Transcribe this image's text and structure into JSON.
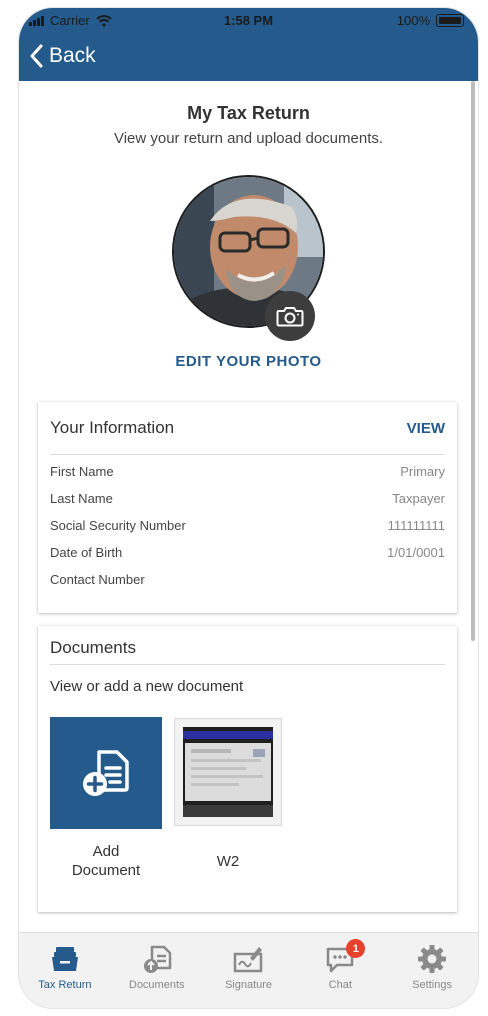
{
  "status_bar": {
    "carrier": "Carrier",
    "time": "1:58 PM",
    "battery": "100%"
  },
  "nav": {
    "back_label": "Back"
  },
  "page": {
    "title": "My Tax Return",
    "subtitle": "View your return and upload documents.",
    "edit_photo": "EDIT YOUR PHOTO"
  },
  "your_information": {
    "title": "Your Information",
    "view_label": "VIEW",
    "rows": [
      {
        "label": "First Name",
        "value": "Primary"
      },
      {
        "label": "Last Name",
        "value": "Taxpayer"
      },
      {
        "label": "Social Security Number",
        "value": "111111111"
      },
      {
        "label": "Date of Birth",
        "value": "1/01/0001"
      },
      {
        "label": "Contact Number",
        "value": ""
      }
    ]
  },
  "documents": {
    "title": "Documents",
    "subtitle": "View or add a new document",
    "add_label_line1": "Add",
    "add_label_line2": "Document",
    "items": [
      {
        "label": "W2"
      }
    ]
  },
  "tabbar": {
    "tabs": [
      {
        "label": "Tax Return",
        "icon": "tax-return-icon",
        "active": true
      },
      {
        "label": "Documents",
        "icon": "documents-icon"
      },
      {
        "label": "Signature",
        "icon": "signature-icon"
      },
      {
        "label": "Chat",
        "icon": "chat-icon",
        "badge": "1"
      },
      {
        "label": "Settings",
        "icon": "gear-icon"
      }
    ]
  },
  "colors": {
    "primary": "#245b8c",
    "badge": "#e8412c",
    "background": "#f5f5f5"
  }
}
